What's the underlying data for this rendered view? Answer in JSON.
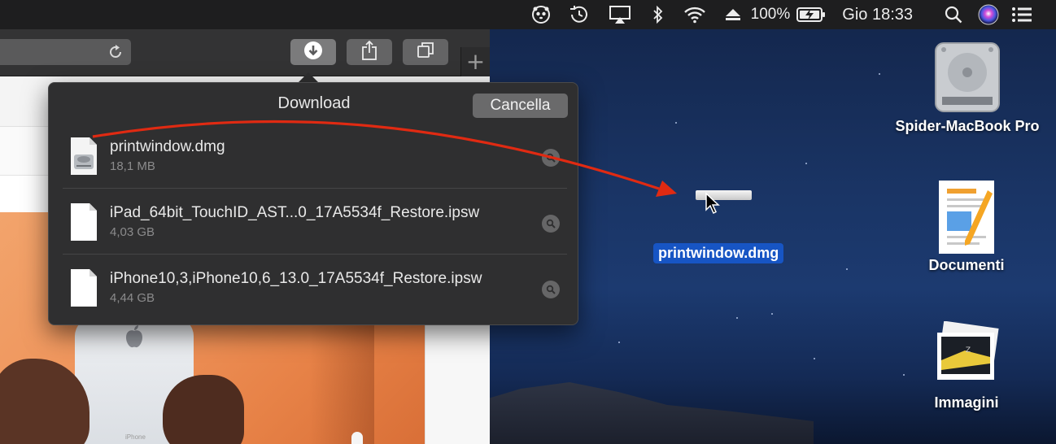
{
  "menubar": {
    "battery_percent": "100%",
    "clock": "Gio 18:33",
    "icons": [
      "panda-icon",
      "time-machine-icon",
      "airplay-icon",
      "bluetooth-icon",
      "wifi-icon",
      "eject-icon",
      "battery-charging-icon",
      "search-icon",
      "siri-icon",
      "notification-center-icon"
    ]
  },
  "safari": {
    "toolbar_buttons": [
      "downloads-button",
      "share-button",
      "tabs-overview-button"
    ],
    "new_tab_symbol": "+",
    "phone_word": "iPhone"
  },
  "downloads": {
    "title": "Download",
    "cancel_label": "Cancella",
    "items": [
      {
        "name": "printwindow.dmg",
        "size": "18,1 MB",
        "icon": "disk-image-icon"
      },
      {
        "name": "iPad_64bit_TouchID_AST...0_17A5534f_Restore.ipsw",
        "size": "4,03 GB",
        "icon": "document-icon"
      },
      {
        "name": "iPhone10,3,iPhone10,6_13.0_17A5534f_Restore.ipsw",
        "size": "4,44 GB",
        "icon": "document-icon"
      }
    ]
  },
  "desktop": {
    "drag_label": "printwindow.dmg",
    "icons": [
      {
        "label": "Spider-MacBook Pro",
        "icon": "hard-drive-icon"
      },
      {
        "label": "Documenti",
        "icon": "pages-document-icon"
      },
      {
        "label": "Immagini",
        "icon": "photos-stack-icon"
      }
    ]
  },
  "colors": {
    "annotation_arrow": "#e02a12",
    "selection": "#1755c4",
    "popover_bg": "#2f2f30"
  }
}
